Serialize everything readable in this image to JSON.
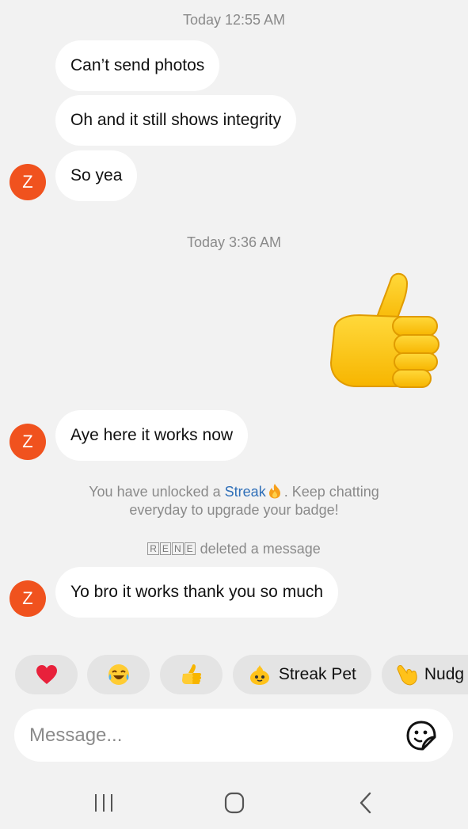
{
  "conversation": {
    "timestamp_1": "Today 12:55 AM",
    "timestamp_2": "Today 3:36 AM",
    "messages": [
      {
        "text": "Can’t send photos"
      },
      {
        "text": "Oh and it still shows integrity"
      },
      {
        "text": "So yea"
      },
      {
        "text": "Aye here it works now"
      },
      {
        "text": "Yo bro it works thank you so much"
      }
    ],
    "thumbs_up_sticker": "thumbs-up-emoji",
    "avatar_initial": "Z",
    "streak_notice": {
      "prefix": "You have unlocked a ",
      "link": "Streak",
      "suffix": ". Keep chatting",
      "line2": "everyday to upgrade your badge!"
    },
    "deleted_notice": {
      "name_letters": [
        "R",
        "E",
        "N",
        "E"
      ],
      "text": "deleted a message"
    }
  },
  "quick_replies": [
    {
      "icon": "red-heart-emoji",
      "label": ""
    },
    {
      "icon": "tears-of-joy-emoji",
      "label": ""
    },
    {
      "icon": "thumbs-up-emoji",
      "label": ""
    },
    {
      "icon": "streak-pet-emoji",
      "label": "Streak Pet"
    },
    {
      "icon": "pointing-hand-emoji",
      "label": "Nudg"
    }
  ],
  "composer": {
    "placeholder": "Message...",
    "value": "",
    "sticker_icon": "sticker-icon"
  },
  "navigation": {
    "recents_icon": "recents-icon",
    "home_icon": "home-icon",
    "back_icon": "back-icon"
  },
  "colors": {
    "background": "#f2f2f2",
    "bubble": "#ffffff",
    "avatar": "#f0521e",
    "streak_link": "#2f6fb8"
  }
}
